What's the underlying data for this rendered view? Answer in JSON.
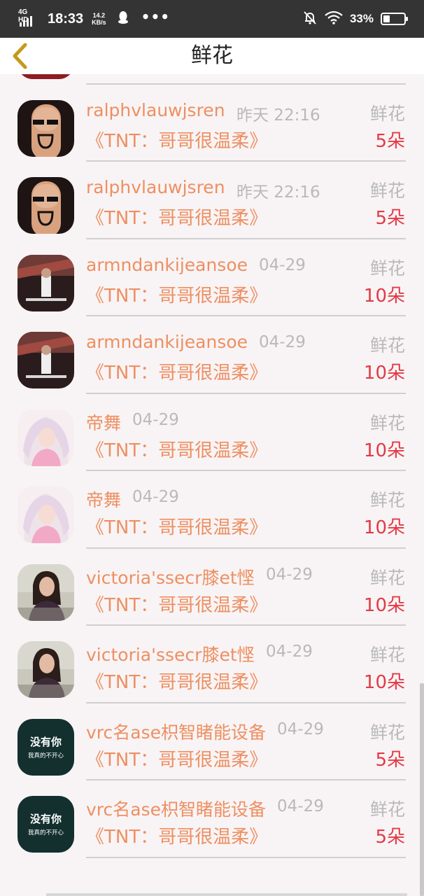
{
  "status_bar": {
    "network": "4G HD",
    "time": "18:33",
    "speed_value": "14.2",
    "speed_unit": "KB/s",
    "more": "•••",
    "battery_pct": "33%",
    "battery_level": 0.33,
    "icons": [
      "signal-icon",
      "qq-icon",
      "mute-icon",
      "wifi-icon",
      "battery-icon"
    ]
  },
  "nav": {
    "back_icon": "chevron-left-icon",
    "title": "鲜花"
  },
  "colors": {
    "accent": "#ee8f62",
    "count": "#e33a45",
    "muted": "#b9b9b9",
    "back": "#c59a1c"
  },
  "rows": [
    {
      "username": "",
      "time": "",
      "type": "鲜花",
      "work": "《TNT：哥哥很温柔》",
      "count": "5朵",
      "avatar": "avatar-photo-red"
    },
    {
      "username": "ralphvlauwjsren",
      "time": "昨天 22:16",
      "type": "鲜花",
      "work": "《TNT：哥哥很温柔》",
      "count": "5朵",
      "avatar": "avatar-finger-face"
    },
    {
      "username": "ralphvlauwjsren",
      "time": "昨天 22:16",
      "type": "鲜花",
      "work": "《TNT：哥哥很温柔》",
      "count": "5朵",
      "avatar": "avatar-finger-face"
    },
    {
      "username": "armndankijeansoe",
      "time": "04-29",
      "type": "鲜花",
      "work": "《TNT：哥哥很温柔》",
      "count": "10朵",
      "avatar": "avatar-dark-photo"
    },
    {
      "username": "armndankijeansoe",
      "time": "04-29",
      "type": "鲜花",
      "work": "《TNT：哥哥很温柔》",
      "count": "10朵",
      "avatar": "avatar-dark-photo"
    },
    {
      "username": "帝舞",
      "time": "04-29",
      "type": "鲜花",
      "work": "《TNT：哥哥很温柔》",
      "count": "10朵",
      "avatar": "avatar-anime-girl"
    },
    {
      "username": "帝舞",
      "time": "04-29",
      "type": "鲜花",
      "work": "《TNT：哥哥很温柔》",
      "count": "10朵",
      "avatar": "avatar-anime-girl"
    },
    {
      "username": "victoria'ssecr膝et悭",
      "time": "04-29",
      "type": "鲜花",
      "work": "《TNT：哥哥很温柔》",
      "count": "10朵",
      "avatar": "avatar-woman-photo"
    },
    {
      "username": "victoria'ssecr膝et悭",
      "time": "04-29",
      "type": "鲜花",
      "work": "《TNT：哥哥很温柔》",
      "count": "10朵",
      "avatar": "avatar-woman-photo"
    },
    {
      "username": "vrc名ase枳智睹能设备",
      "time": "04-29",
      "type": "鲜花",
      "work": "《TNT：哥哥很温柔》",
      "count": "5朵",
      "avatar": "avatar-text-tile",
      "avatar_text": [
        "没有你",
        "我真的不开心"
      ]
    },
    {
      "username": "vrc名ase枳智睹能设备",
      "time": "04-29",
      "type": "鲜花",
      "work": "《TNT：哥哥很温柔》",
      "count": "5朵",
      "avatar": "avatar-text-tile",
      "avatar_text": [
        "没有你",
        "我真的不开心"
      ]
    }
  ]
}
